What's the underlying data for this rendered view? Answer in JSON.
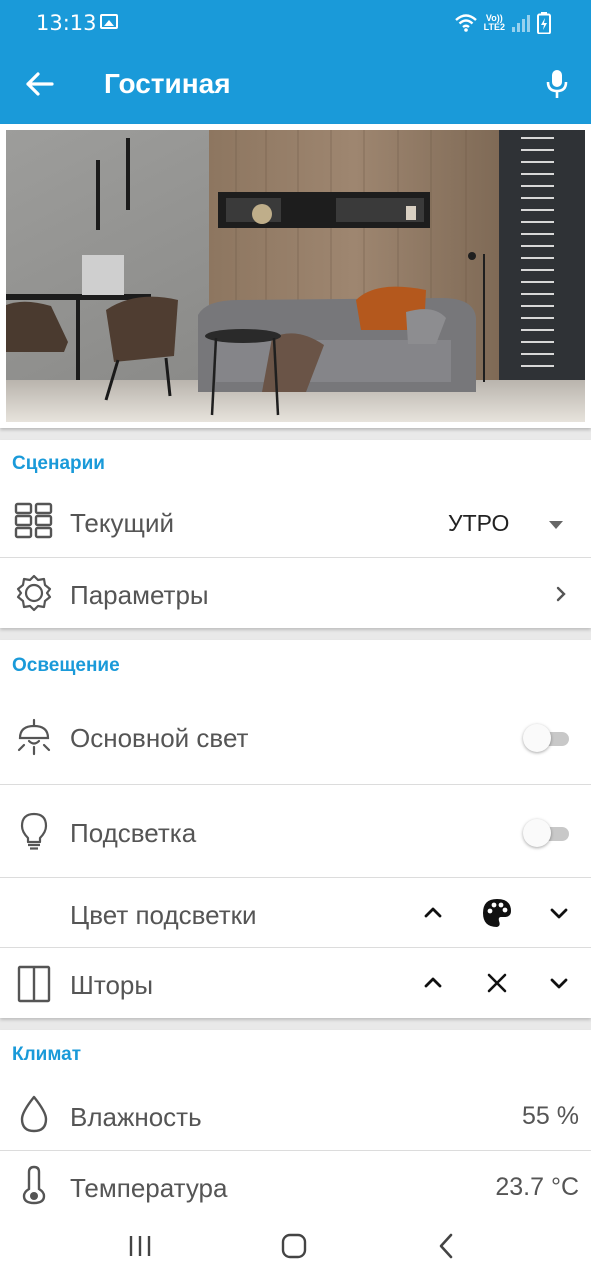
{
  "status_bar": {
    "time": "13:13",
    "network_top": "Vo))",
    "network_bottom": "LTE2",
    "icons": [
      "image-icon",
      "wifi-icon",
      "signal-icon",
      "battery-charging-icon"
    ]
  },
  "app_bar": {
    "title": "Гостиная",
    "icons": [
      "back-arrow-icon",
      "microphone-icon"
    ]
  },
  "room_photo": {
    "subject": "living-room-interior"
  },
  "scenarios": {
    "title": "Сценарии",
    "current_label": "Текущий",
    "current_value": "УТРО",
    "params_label": "Параметры",
    "icons": [
      "grid-icon",
      "dropdown-arrow-icon",
      "settings-gear-icon",
      "chevron-right-icon"
    ]
  },
  "lighting": {
    "title": "Освещение",
    "main_light_label": "Основной свет",
    "main_light_on": false,
    "backlight_label": "Подсветка",
    "backlight_on": false,
    "backlight_color_label": "Цвет подсветки",
    "curtains_label": "Шторы",
    "icons": [
      "ceiling-lamp-icon",
      "light-bulb-icon",
      "chevron-up-icon",
      "palette-icon",
      "chevron-down-icon",
      "curtains-icon",
      "close-x-icon"
    ]
  },
  "climate": {
    "title": "Климат",
    "humidity_label": "Влажность",
    "humidity_value": "55 %",
    "temperature_label": "Температура",
    "temperature_value": "23.7 °C",
    "icons": [
      "water-drop-icon",
      "thermometer-icon"
    ]
  },
  "colors": {
    "accent": "#1a9ad9",
    "text": "#555555",
    "background": "#e9e9e9"
  }
}
